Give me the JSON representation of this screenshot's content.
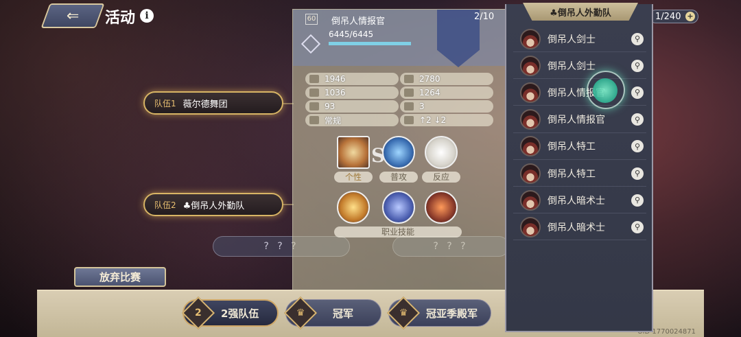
{
  "header": {
    "back_icon": "back-arrow-icon",
    "title": "活动",
    "info": "i"
  },
  "bracket": {
    "team1": {
      "tag": "队伍1",
      "name": "薇尔德舞团"
    },
    "team2": {
      "tag": "队伍2",
      "name": "♣倒吊人外勤队"
    },
    "unknown": "? ? ?"
  },
  "forfeit_label": "放弃比赛",
  "stages": [
    {
      "label": "2强队伍",
      "badge": "2"
    },
    {
      "label": "冠军",
      "badge": "trophy"
    },
    {
      "label": "冠亚季殿军",
      "badge": "trophy"
    }
  ],
  "uid": "UID 1770024871",
  "character": {
    "level": "60",
    "name": "倒吊人情报官",
    "hp": "6445/6445",
    "hp_fraction": 1.0,
    "count": "2/10",
    "stats": [
      "1946",
      "2780",
      "1036",
      "1264",
      "93",
      "3",
      "常规",
      "↑2 ↓2"
    ],
    "skills": [
      "个性",
      "普攻",
      "反应"
    ],
    "rank": "S",
    "job_skills_label": "职业技能"
  },
  "roster": {
    "title": "♣倒吊人外勤队",
    "count": "1/240",
    "members": [
      "倒吊人剑士",
      "倒吊人剑士",
      "倒吊人情报官",
      "倒吊人情报官",
      "倒吊人特工",
      "倒吊人特工",
      "倒吊人暗术士",
      "倒吊人暗术士"
    ]
  }
}
